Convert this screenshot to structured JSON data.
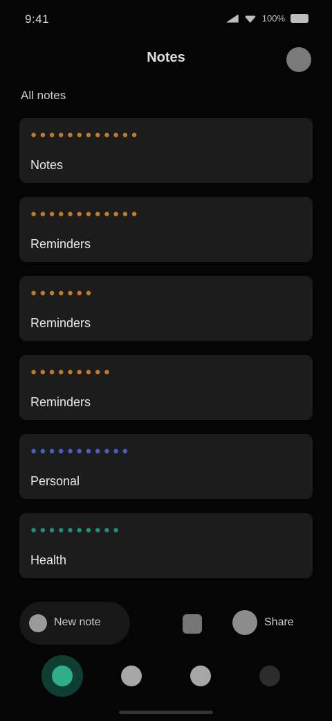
{
  "status_bar": {
    "time": "9:41",
    "battery": "100%"
  },
  "top_bar": {
    "title": "Notes"
  },
  "section": {
    "title": "All notes"
  },
  "cards": [
    {
      "label": "● ● ● ● ● ● ● ● ● ● ● ●",
      "sub": "Notes",
      "color": "#c07a2a"
    },
    {
      "label": "● ● ● ● ● ● ● ● ● ● ● ●",
      "sub": "Reminders",
      "color": "#c07a2a"
    },
    {
      "label": "● ● ● ● ● ● ●",
      "sub": "Reminders",
      "color": "#c07a2a"
    },
    {
      "label": "● ● ● ● ● ● ● ● ●",
      "sub": "Reminders",
      "color": "#c07a2a"
    },
    {
      "label": "● ● ● ● ● ● ● ● ● ● ●",
      "sub": "Personal",
      "color": "#4a5ec4"
    },
    {
      "label": "● ● ● ● ● ● ● ● ● ●",
      "sub": "Health",
      "color": "#1f8f7a"
    }
  ],
  "bottom_actions": {
    "pill_text": "New note",
    "right_text": "Share"
  },
  "nav": {
    "items": [
      {
        "name": "home"
      },
      {
        "name": "explore"
      },
      {
        "name": "profile"
      },
      {
        "name": "more"
      }
    ]
  }
}
